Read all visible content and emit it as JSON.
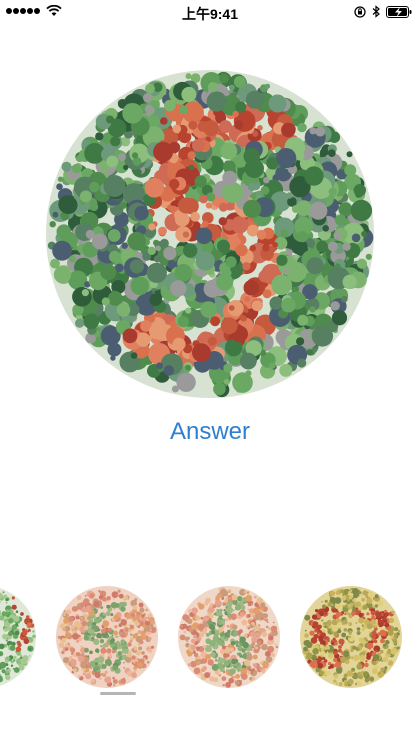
{
  "status_bar": {
    "time": "上午9:41",
    "icons": [
      "signal-dots-icon",
      "wifi-icon",
      "orientation-lock-icon",
      "bluetooth-icon",
      "battery-icon"
    ]
  },
  "main": {
    "answer_label": "Answer",
    "accent_color": "#2f7fd0"
  },
  "thumbnails": {
    "selected_index": 1,
    "count": 4
  }
}
